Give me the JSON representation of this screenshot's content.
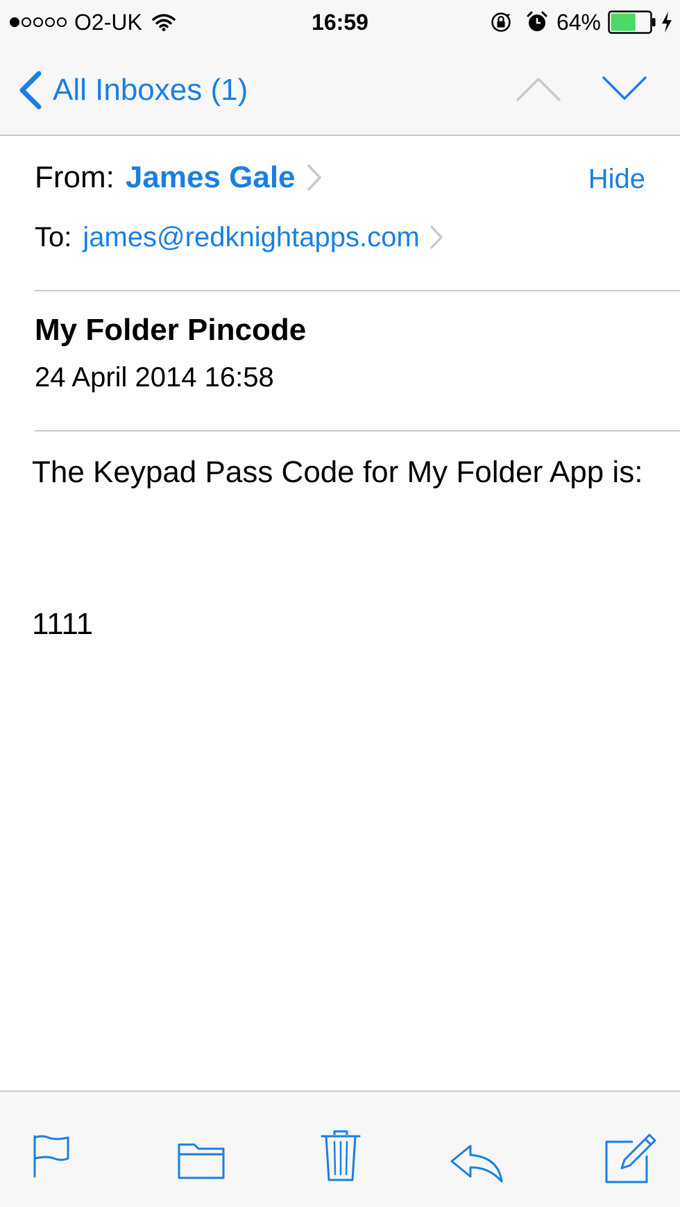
{
  "status_bar": {
    "carrier": "O2-UK",
    "signal_bars_filled": 1,
    "signal_bars_total": 5,
    "time": "16:59",
    "battery_percent": "64%",
    "battery_level": 0.64,
    "icons": [
      "wifi-icon",
      "rotation-lock-icon",
      "alarm-icon",
      "battery-icon",
      "charging-icon"
    ]
  },
  "nav": {
    "back_label": "All Inboxes (1)",
    "icons": [
      "back-chevron-icon",
      "chevron-up-icon",
      "chevron-down-icon"
    ]
  },
  "header": {
    "from_prefix": "From:",
    "from_name": "James Gale",
    "hide_label": "Hide",
    "to_prefix": "To:",
    "to_address": "james@redknightapps.com"
  },
  "message": {
    "subject": "My Folder Pincode",
    "date": "24 April 2014 16:58",
    "body_line1": "The Keypad Pass Code for My Folder App is:",
    "body_code": "1111"
  },
  "toolbar": {
    "icons": [
      "flag-icon",
      "folder-icon",
      "trash-icon",
      "reply-icon",
      "compose-icon"
    ]
  },
  "colors": {
    "accent": "#1a7fe3",
    "bar_background": "#f7f7f8",
    "divider": "#c8c7cc",
    "battery_fill": "#4cd964",
    "disabled": "#c7c7cc"
  }
}
